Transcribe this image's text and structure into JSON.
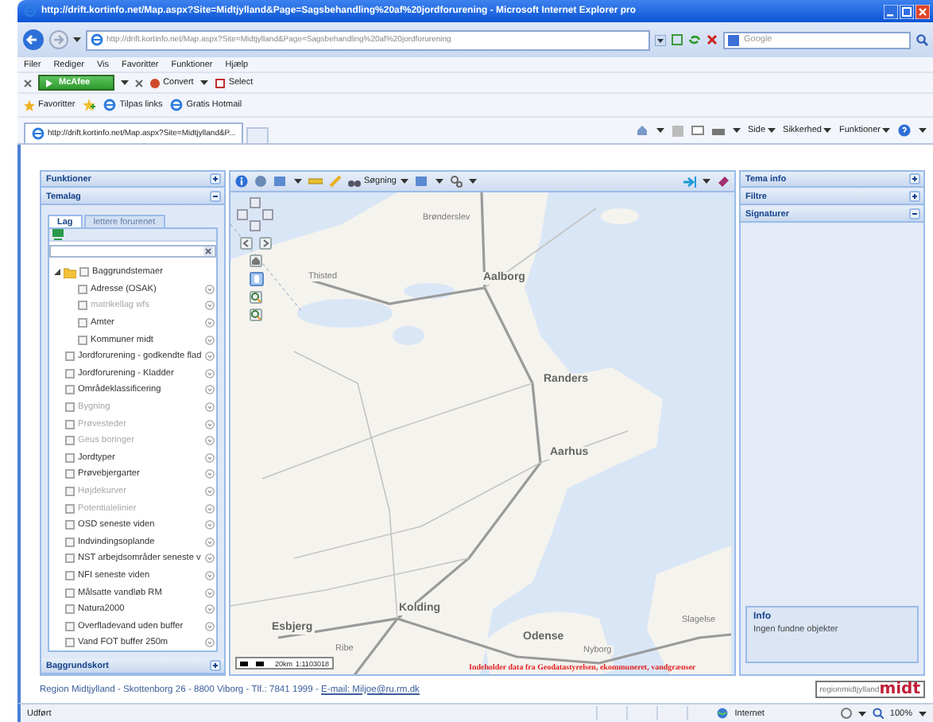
{
  "browser": {
    "title": "http://drift.kortinfo.net/Map.aspx?Site=Midtjylland&Page=Sagsbehandling%20af%20jordforurening - Microsoft Internet Explorer pro",
    "address": "http://drift.kortinfo.net/Map.aspx?Site=Midtjylland&Page=Sagsbehandling%20af%20jordforurening",
    "search_placeholder": "Google",
    "menu": [
      "Filer",
      "Rediger",
      "Vis",
      "Favoritter",
      "Funktioner",
      "Hjælp"
    ],
    "toolbar": {
      "mcafee": "McAfee",
      "convert": "Convert",
      "select": "Select"
    },
    "favorites": {
      "label": "Favoritter",
      "links": [
        "Tilpas links",
        "Gratis Hotmail"
      ]
    },
    "tabs": [
      {
        "label": "http://drift.kortinfo.net/Map.aspx?Site=Midtjylland&P...",
        "selected": true
      }
    ],
    "commands": [
      "Side",
      "Sikkerhed",
      "Funktioner"
    ],
    "status": {
      "text": "Udført",
      "zone": "Internet",
      "zoom": "100%"
    }
  },
  "left_panels": [
    {
      "title": "Funktioner",
      "expanded": false
    },
    {
      "title": "Temalag",
      "expanded": true
    },
    {
      "title": "Baggrundskort",
      "expanded": false
    }
  ],
  "temalag": {
    "tabs": [
      {
        "label": "Lag",
        "selected": true
      },
      {
        "label": "lettere forurenet",
        "selected": false
      }
    ],
    "layers": [
      {
        "label": "Baggrundstemaer",
        "checked": false,
        "disabled": false,
        "expanded": true,
        "children": [
          {
            "label": "Adresse (OSAK)",
            "checked": false,
            "disabled": false
          },
          {
            "label": "matrikellag wfs",
            "checked": false,
            "disabled": true
          },
          {
            "label": "Amter",
            "checked": false,
            "disabled": false
          },
          {
            "label": "Kommuner midt",
            "checked": false,
            "disabled": false
          }
        ]
      },
      {
        "label": "Jordforurening - godkendte flad",
        "checked": false,
        "disabled": false
      },
      {
        "label": "Jordforurening - Kladder",
        "checked": false,
        "disabled": false
      },
      {
        "label": "Områdeklassificering",
        "checked": false,
        "disabled": false
      },
      {
        "label": "Bygning",
        "checked": false,
        "disabled": true
      },
      {
        "label": "Prøvesteder",
        "checked": false,
        "disabled": true
      },
      {
        "label": "Geus boringer",
        "checked": false,
        "disabled": true
      },
      {
        "label": "Jordtyper",
        "checked": false,
        "disabled": false
      },
      {
        "label": "Prøvebjergarter",
        "checked": false,
        "disabled": false
      },
      {
        "label": "Højdekurver",
        "checked": false,
        "disabled": true
      },
      {
        "label": "Potentialelinier",
        "checked": false,
        "disabled": true
      },
      {
        "label": "OSD seneste viden",
        "checked": false,
        "disabled": false
      },
      {
        "label": "Indvindingsoplande",
        "checked": false,
        "disabled": false
      },
      {
        "label": "NST arbejdsområder seneste v",
        "checked": false,
        "disabled": false
      },
      {
        "label": "NFI seneste viden",
        "checked": false,
        "disabled": false
      },
      {
        "label": "Målsatte vandløb RM",
        "checked": false,
        "disabled": false
      },
      {
        "label": "Natura2000",
        "checked": false,
        "disabled": false
      },
      {
        "label": "Overfladevand uden buffer",
        "checked": false,
        "disabled": false
      },
      {
        "label": "Vand FOT buffer 250m",
        "checked": false,
        "disabled": false
      }
    ]
  },
  "map": {
    "toolbar": {
      "search": "Søgning"
    },
    "cities": [
      {
        "name": "Brønderslev",
        "major": false
      },
      {
        "name": "Thisted",
        "major": false
      },
      {
        "name": "Aalborg",
        "major": true
      },
      {
        "name": "Randers",
        "major": true
      },
      {
        "name": "Aarhus",
        "major": true
      },
      {
        "name": "Kolding",
        "major": true
      },
      {
        "name": "Esbjerg",
        "major": true
      },
      {
        "name": "Ribe",
        "major": false
      },
      {
        "name": "Odense",
        "major": true
      },
      {
        "name": "Nyborg",
        "major": false
      },
      {
        "name": "Slagelse",
        "major": false
      }
    ],
    "scale": "20km",
    "ratio": "1:1103018",
    "attribution": "Indeholder data fra Geodatastyrelsen, ekommuneret, vandgrænser"
  },
  "right_panels": [
    {
      "title": "Tema info",
      "expanded": false
    },
    {
      "title": "Filtre",
      "expanded": false
    },
    {
      "title": "Signaturer",
      "expanded": true
    }
  ],
  "info": {
    "title": "Info",
    "text": "Ingen fundne objekter"
  },
  "footer": {
    "text": "Region Midtjylland - Skottenborg 26 - 8800 Viborg - Tlf.: 7841 1999 - ",
    "email": "E-mail: Miljoe@ru.rm.dk",
    "logo_text": "regionmidtjylland",
    "logo_mark": "midt"
  }
}
